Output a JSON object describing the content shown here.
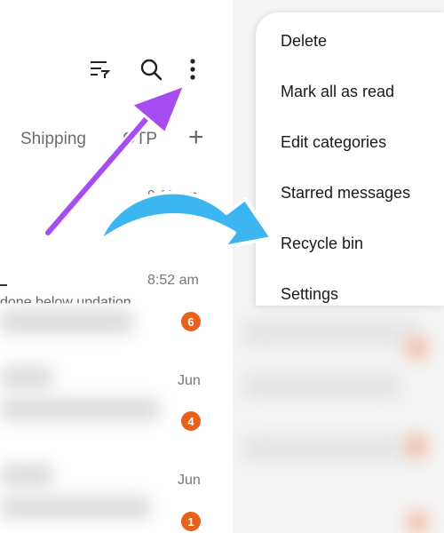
{
  "tabs": {
    "shipping": "Shipping",
    "otp": "OTP",
    "add": "+"
  },
  "conversations": [
    {
      "time": "9:11 am"
    },
    {
      "time": "8:52 am",
      "preview": "done below updation",
      "unread": "6"
    },
    {
      "time": "Jun",
      "unread": "4"
    },
    {
      "time": "Jun",
      "unread": "1"
    }
  ],
  "menu": {
    "delete": "Delete",
    "mark_all_read": "Mark all as read",
    "edit_categories": "Edit categories",
    "starred": "Starred messages",
    "recycle_bin": "Recycle bin",
    "settings": "Settings"
  },
  "icons": {
    "filter": "sort-filter-icon",
    "search": "search-icon",
    "more": "more-options-icon"
  },
  "colors": {
    "badge": "#e8611a",
    "purple_arrow": "#a64cf0",
    "blue_arrow": "#3cb6f0"
  }
}
